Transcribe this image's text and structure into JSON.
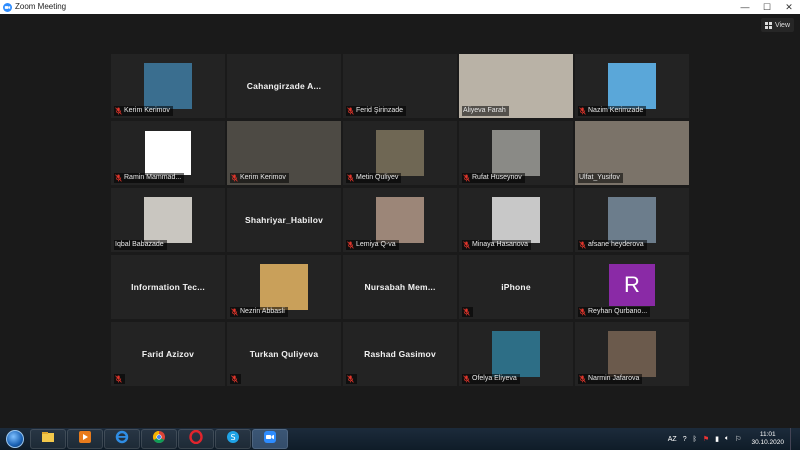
{
  "window": {
    "title": "Zoom Meeting",
    "minimize": "—",
    "maximize": "☐",
    "close": "✕"
  },
  "toolbar": {
    "view_label": "View"
  },
  "tiles": [
    {
      "name": "Kerim Kerimov",
      "kind": "video",
      "style": "sq",
      "bg": "#3a6e8f",
      "muted": true
    },
    {
      "name": "Cahangirzade  A...",
      "kind": "nametile"
    },
    {
      "name": "Ferid Şirinzade",
      "kind": "label-only",
      "muted": true
    },
    {
      "name": "Aliyeva Farah",
      "kind": "video",
      "style": "wide",
      "bg": "#b9b2a6",
      "muted": false,
      "active": true
    },
    {
      "name": "Nazim Kerimzade",
      "kind": "video",
      "style": "sq",
      "bg": "#5aa7d9",
      "muted": true
    },
    {
      "name": "Ramin Mammad...",
      "kind": "video",
      "style": "white",
      "bg": "#ffffff",
      "muted": true
    },
    {
      "name": "Kerim Kerimov",
      "kind": "video",
      "style": "wide",
      "bg": "#4d4a44",
      "muted": true
    },
    {
      "name": "Metin Quliyev",
      "kind": "video",
      "style": "sq",
      "bg": "#6f6754",
      "muted": true
    },
    {
      "name": "Rufat Huseynov",
      "kind": "video",
      "style": "sq",
      "bg": "#8a8a86",
      "muted": true
    },
    {
      "name": "Ulfat_Yusifov",
      "kind": "video",
      "style": "wide",
      "bg": "#7b7369",
      "muted": false
    },
    {
      "name": "Iqbal Babazade",
      "kind": "video",
      "style": "sq",
      "bg": "#c9c6c0",
      "muted": false
    },
    {
      "name": "Shahriyar_Habilov",
      "kind": "nametile"
    },
    {
      "name": "Lemiya Q-va",
      "kind": "video",
      "style": "sq",
      "bg": "#9c8678",
      "muted": true
    },
    {
      "name": "Minaya Hasanova",
      "kind": "video",
      "style": "sq",
      "bg": "#c8c8c8",
      "muted": true
    },
    {
      "name": "afsane heyderova",
      "kind": "video",
      "style": "sq",
      "bg": "#6c7d8c",
      "muted": true
    },
    {
      "name": "Information  Tec...",
      "kind": "nametile"
    },
    {
      "name": "Nezrin Abbasli",
      "kind": "video",
      "style": "sq",
      "bg": "#c9a05a",
      "muted": true
    },
    {
      "name": "Nursabah  Mem...",
      "kind": "nametile"
    },
    {
      "name": "iPhone",
      "kind": "nametile-muted",
      "muted": true
    },
    {
      "name": "Reyhan Qurbano...",
      "kind": "avatar",
      "initial": "R",
      "muted": true
    },
    {
      "name": "Farid Azizov",
      "kind": "nametile-muted",
      "muted": true
    },
    {
      "name": "Turkan Quliyeva",
      "kind": "nametile-muted",
      "muted": true
    },
    {
      "name": "Rashad Gasimov",
      "kind": "nametile-muted",
      "muted": true
    },
    {
      "name": "Ofelya Eliyeva",
      "kind": "video",
      "style": "sq",
      "bg": "#2d6e86",
      "muted": true
    },
    {
      "name": "Narmin Jafarova",
      "kind": "video",
      "style": "sq",
      "bg": "#6b5a4c",
      "muted": true
    }
  ],
  "taskbar": {
    "apps": [
      "explorer-icon",
      "media-player-icon",
      "internet-explorer-icon",
      "chrome-icon",
      "opera-icon",
      "skype-icon",
      "zoom-icon"
    ],
    "lang": "AZ",
    "time": "11:01",
    "date": "30.10.2020"
  },
  "colors": {
    "active_border": "#b7d23a",
    "mute_red": "#e0352b",
    "avatar_purple": "#8a2aa6"
  }
}
